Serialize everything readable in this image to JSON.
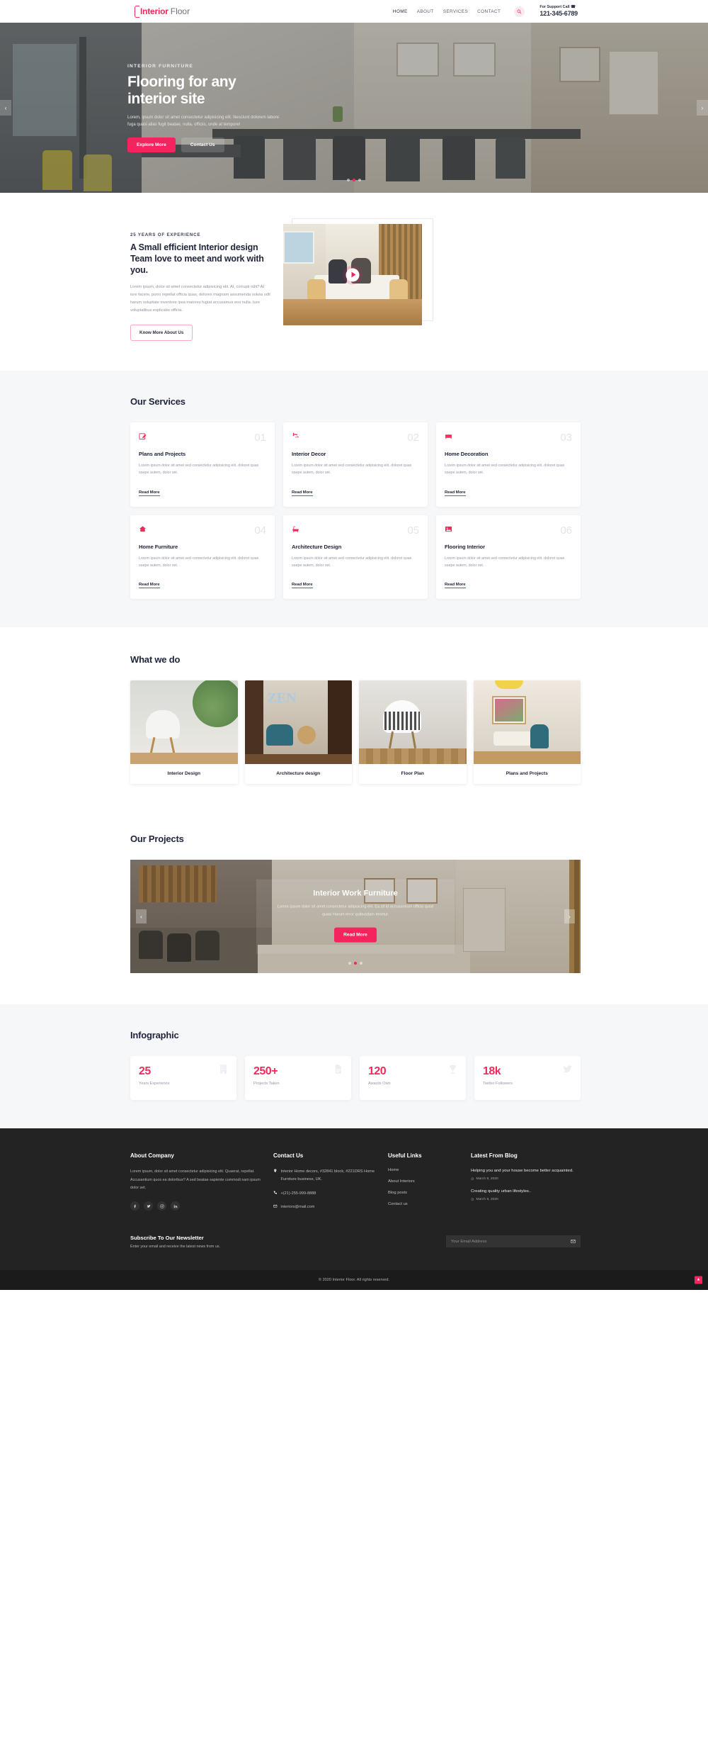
{
  "header": {
    "logo_strong": "Interior",
    "logo_light": "Floor",
    "nav": [
      {
        "label": "HOME",
        "active": true
      },
      {
        "label": "ABOUT",
        "active": false
      },
      {
        "label": "SERVICES",
        "active": false
      },
      {
        "label": "CONTACT",
        "active": false
      }
    ],
    "search_icon": "search-icon",
    "support_label": "For Support Call ☎",
    "support_phone": "121-345-6789"
  },
  "hero": {
    "kicker": "INTERIOR FURNITURE",
    "title": "Flooring for any interior site",
    "text": "Lorem, ipsum dolor sit amet consectetur adipisicing elit. Nesciunt dolorem labore fuga quasi alias fugit beatae, nulla, officiis, unde at tempore!",
    "btn_primary": "Explore More",
    "btn_secondary": "Contact Us",
    "prev_icon": "chevron-left-icon",
    "next_icon": "chevron-right-icon",
    "slides": 3,
    "active_slide": 2
  },
  "about": {
    "kicker": "25 YEARS OF EXPERIENCE",
    "title": "A Small efficient Interior design Team love to meet and work with you.",
    "text": "Lorem ipsum, dolor sit amet consectetur adipisicing elit. At, corrupti odit? At iure facere, porro repellat officia quas, dolores magnam assumenda soluta odit harum voluptate inventore ipsa maiores fugiat accusamus eos nulla. Iure voluptatibus explicabo officia.",
    "button": "Know More About Us",
    "play_icon": "play-icon"
  },
  "services": {
    "title": "Our Services",
    "read_more": "Read More",
    "cards": [
      {
        "num": "01",
        "name": "Plans and Projects",
        "icon": "pencil-square-icon",
        "desc": "Lorem ipsum dolor sit amet sed consectetur adipisicing elit. doloret quas saepe autem, dolor set."
      },
      {
        "num": "02",
        "name": "Interior Decor",
        "icon": "shower-icon",
        "desc": "Lorem ipsum dolor sit amet sed consectetur adipisicing elit. doloret quas saepe autem, dolor set."
      },
      {
        "num": "03",
        "name": "Home Decoration",
        "icon": "bed-icon",
        "desc": "Lorem ipsum dolor sit amet sed consectetur adipisicing elit. doloret quas saepe autem, dolor set."
      },
      {
        "num": "04",
        "name": "Home Furniture",
        "icon": "home-icon",
        "desc": "Lorem ipsum dolor sit amet sed consectetur adipisicing elit. doloret quas saepe autem, dolor set."
      },
      {
        "num": "05",
        "name": "Architecture Design",
        "icon": "bathtub-icon",
        "desc": "Lorem ipsum dolor sit amet sed consectetur adipisicing elit. doloret quas saepe autem, dolor set."
      },
      {
        "num": "06",
        "name": "Flooring Interior",
        "icon": "image-icon",
        "desc": "Lorem ipsum dolor sit amet sed consectetur adipisicing elit. doloret quas saepe autem, dolor set."
      }
    ]
  },
  "whatwedo": {
    "title": "What we do",
    "cards": [
      {
        "label": "Interior Design"
      },
      {
        "label": "Architecture design"
      },
      {
        "label": "Floor Plan"
      },
      {
        "label": "Plans and Projects"
      }
    ]
  },
  "projects": {
    "title": "Our Projects",
    "slide_title": "Interior Work Furniture",
    "slide_text": "Lorem ipsum dolor sit amet consectetur adipisicing elit. Ea sit id accusantium officia quod quasi Harum error quibusdam tenetur.",
    "button": "Read More",
    "prev_icon": "chevron-left-icon",
    "next_icon": "chevron-right-icon",
    "slides": 3,
    "active_slide": 2
  },
  "infographic": {
    "title": "Infographic",
    "cards": [
      {
        "value": "25",
        "label": "Years Experience",
        "icon": "building-icon"
      },
      {
        "value": "250+",
        "label": "Projects Taken",
        "icon": "document-icon"
      },
      {
        "value": "120",
        "label": "Awards Own",
        "icon": "trophy-icon"
      },
      {
        "value": "18k",
        "label": "Twitter Followers",
        "icon": "twitter-icon"
      }
    ]
  },
  "footer": {
    "about": {
      "heading": "About Company",
      "text": "Lorem ipsum, dolor sit amet consectetur adipisicing elit. Quaerat, repellat. Accusantium quos ea doloribus? A sed beatae sapiente commodi nam ipsum dolor set.",
      "socials": [
        "facebook-icon",
        "twitter-icon",
        "instagram-icon",
        "linkedin-icon"
      ]
    },
    "contact": {
      "heading": "Contact Us",
      "address": "Interior Home decors, #32841 block, #221DRS Home Furniture business, UK.",
      "phone": "+(21)-255-999-8888",
      "email": "interiors@mail.com"
    },
    "links": {
      "heading": "Useful Links",
      "items": [
        "Home",
        "About Interiors",
        "Blog posts",
        "Contact us"
      ]
    },
    "blog": {
      "heading": "Latest From Blog",
      "posts": [
        {
          "title": "Helping you and your house become better acquainted.",
          "date": "March 9, 2020"
        },
        {
          "title": "Creating quality urban lifestyles..",
          "date": "March 9, 2020"
        }
      ]
    },
    "newsletter": {
      "heading": "Subscribe To Our Newsletter",
      "subtext": "Enter your email and receive the latest news from us.",
      "placeholder": "Your Email Address",
      "submit_icon": "envelope-icon"
    },
    "copyright": "© 2020 Interior Floor. All rights reserved.",
    "to_top_icon": "arrow-up-icon"
  },
  "colors": {
    "accent": "#f5245f",
    "accent_dark": "#ef2b5b",
    "dark": "#22263c",
    "footer_bg": "#232323"
  }
}
